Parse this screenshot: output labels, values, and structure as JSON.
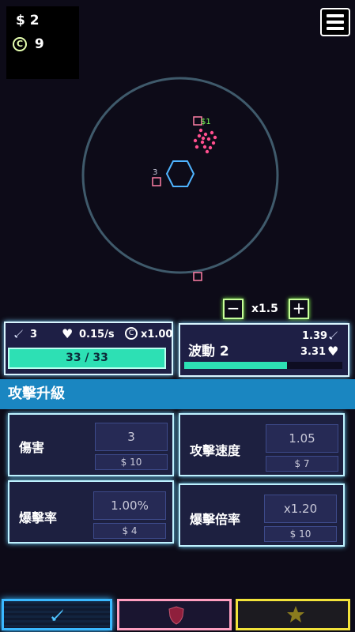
{
  "currency": {
    "cash": "$ 2",
    "coin_symbol": "©",
    "coins": "9"
  },
  "arena": {
    "enemy_cash_popup": "$1",
    "tower_label": "3"
  },
  "speed": {
    "minus": "−",
    "multiplier": "x1.5",
    "plus": "+"
  },
  "player_stats": {
    "attack": "3",
    "regen": "0.15/s",
    "coin_symbol": "©",
    "coin_mult": "x1.00",
    "health": "33 / 33",
    "health_fraction": 1.0
  },
  "wave": {
    "label": "波動 2",
    "enemy_attack": "1.39",
    "enemy_health": "3.31",
    "progress_fraction": 0.65
  },
  "section": {
    "title": "攻擊升級"
  },
  "upgrades": [
    {
      "name": "傷害",
      "value": "3",
      "cost": "$ 10"
    },
    {
      "name": "攻擊速度",
      "value": "1.05",
      "cost": "$ 7"
    },
    {
      "name": "爆擊率",
      "value": "1.00%",
      "cost": "$ 4"
    },
    {
      "name": "爆擊倍率",
      "value": "x1.20",
      "cost": "$ 10"
    }
  ],
  "tabs": [
    {
      "icon": "sword-icon",
      "color": "#4fc3ff"
    },
    {
      "icon": "shield-icon",
      "color": "#ff7fa6"
    },
    {
      "icon": "star-icon",
      "color": "#f2e33a"
    }
  ],
  "colors": {
    "accent_teal": "#2de0b4",
    "header_blue": "#1a86c1",
    "enemy_pink": "#ff4f8e",
    "tower_blue": "#4fb4ff",
    "speed_green": "#86ff4a"
  }
}
